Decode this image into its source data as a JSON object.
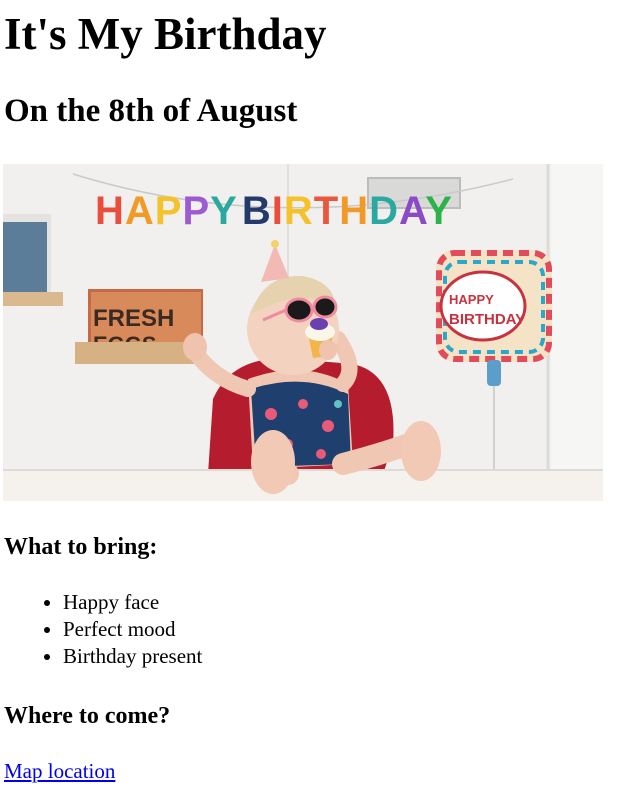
{
  "page": {
    "title": "It's My Birthday",
    "subtitle": "On the 8th of August"
  },
  "banner_text": "HAPPY BIRTHDAY",
  "bring": {
    "heading": "What to bring:",
    "items": [
      "Happy face",
      "Perfect mood",
      "Birthday present"
    ]
  },
  "where": {
    "heading": "Where to come?",
    "link_label": "Map location"
  }
}
